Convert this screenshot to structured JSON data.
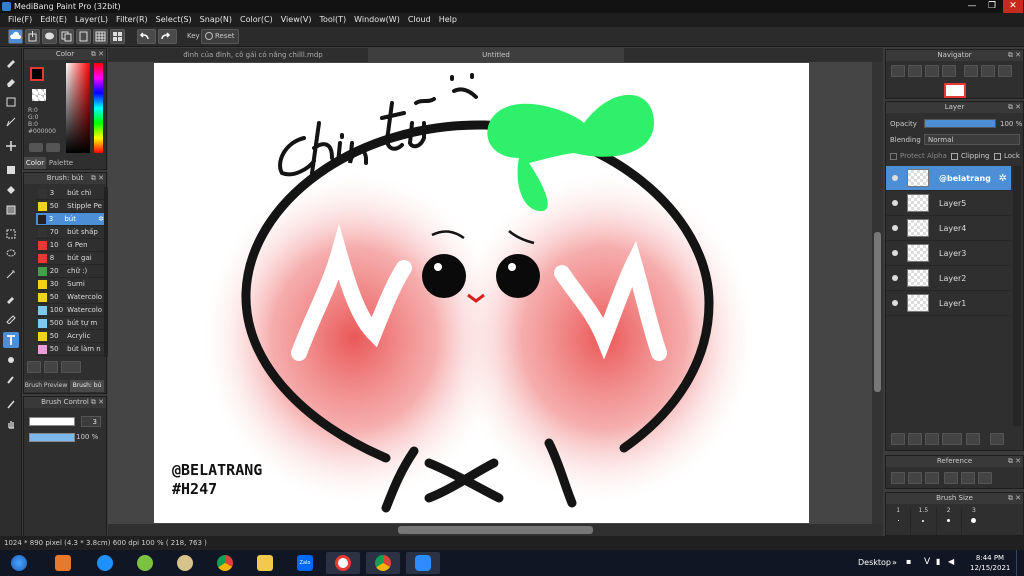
{
  "window": {
    "title": "MediBang Paint Pro (32bit)",
    "minimize": "—",
    "maximize": "❐",
    "close": "✕"
  },
  "menu": [
    "File(F)",
    "Edit(E)",
    "Layer(L)",
    "Filter(R)",
    "Select(S)",
    "Snap(N)",
    "Color(C)",
    "View(V)",
    "Tool(T)",
    "Window(W)",
    "Cloud",
    "Help"
  ],
  "toolbar": {
    "key_label": "Key",
    "reset_label": "Reset"
  },
  "tabs": [
    {
      "label": "đinh của đinh, cô gái có nắng chilll.mdp"
    },
    {
      "label": "Untitled"
    }
  ],
  "color_panel": {
    "title": "Color",
    "r": "R:0",
    "g": "G:0",
    "b": "B:0",
    "hex": "#000000",
    "tab_color": "Color",
    "tab_palette": "Palette",
    "fg": "#000000",
    "bg": "#ffffff"
  },
  "brush_panel": {
    "title": "Brush: bút",
    "items": [
      {
        "size": "3",
        "name": "bút chì",
        "color": "#333333"
      },
      {
        "size": "50",
        "name": "Stipple Pe",
        "color": "#f2d21b"
      },
      {
        "size": "3",
        "name": "bút",
        "color": "#222222",
        "selected": true
      },
      {
        "size": "70",
        "name": "bút shấp",
        "color": "#333333"
      },
      {
        "size": "10",
        "name": "G Pen",
        "color": "#e53935"
      },
      {
        "size": "8",
        "name": "bút gai",
        "color": "#e53935"
      },
      {
        "size": "20",
        "name": "chữ :)",
        "color": "#43a047"
      },
      {
        "size": "30",
        "name": "Sumi",
        "color": "#f2d21b"
      },
      {
        "size": "50",
        "name": "Watercolo",
        "color": "#f2d21b"
      },
      {
        "size": "100",
        "name": "Watercolo",
        "color": "#7ec8f0"
      },
      {
        "size": "500",
        "name": "bút tự m",
        "color": "#7ec8f0"
      },
      {
        "size": "50",
        "name": "Acrylic",
        "color": "#f2d21b"
      },
      {
        "size": "50",
        "name": "bút làm n",
        "color": "#e89fd9"
      }
    ],
    "tab_preview": "Brush Preview",
    "tab_brush": "Brush: bú"
  },
  "brush_control": {
    "title": "Brush Control",
    "size": "3",
    "opacity": "100 %"
  },
  "navigator": {
    "title": "Navigator"
  },
  "layer_panel": {
    "title": "Layer",
    "opacity_label": "Opacity",
    "opacity_value": "100 %",
    "opacity_fraction": 1.0,
    "blending_label": "Blending",
    "blending_value": "Normal",
    "protect_alpha": "Protect Alpha",
    "clipping": "Clipping",
    "lock": "Lock",
    "layers": [
      {
        "name": "@belatrang",
        "selected": true
      },
      {
        "name": "Layer5"
      },
      {
        "name": "Layer4"
      },
      {
        "name": "Layer3"
      },
      {
        "name": "Layer2"
      },
      {
        "name": "Layer1"
      }
    ]
  },
  "reference": {
    "title": "Reference"
  },
  "brush_size": {
    "title": "Brush Size",
    "sizes": [
      "1",
      "1.5",
      "2",
      "3"
    ]
  },
  "canvas": {
    "lettering": "Chin Tũ",
    "signature_1": "@BELATRANG",
    "signature_2": "#H247"
  },
  "status": {
    "text": "1024 * 890 pixel   (4.3 * 3.8cm)   600 dpi   100 %   ( 218, 763 )"
  },
  "taskbar": {
    "desktop": "Desktop",
    "time": "8:44 PM",
    "date": "12/15/2021",
    "zalo": "Zalo"
  }
}
